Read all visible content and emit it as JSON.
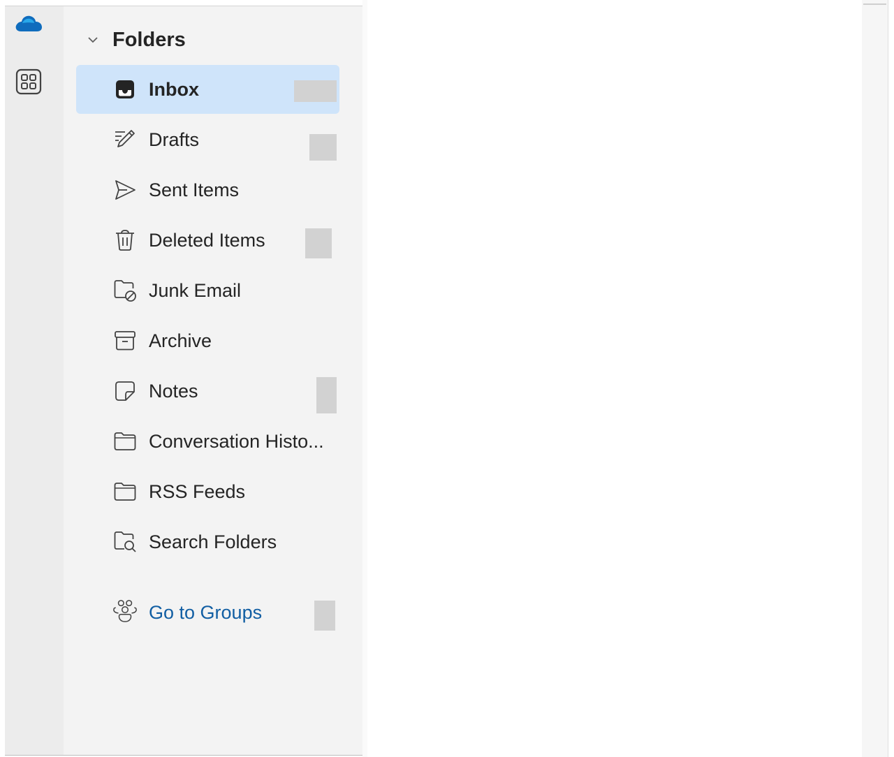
{
  "rail": {
    "app_icon": "onedrive-cloud-icon",
    "apps_icon": "apps-grid-icon",
    "accent": "#0f6cbd"
  },
  "folders": {
    "section_title": "Folders",
    "items": [
      {
        "label": "Inbox",
        "icon": "inbox-icon",
        "selected": true
      },
      {
        "label": "Drafts",
        "icon": "drafts-pencil-icon"
      },
      {
        "label": "Sent Items",
        "icon": "send-icon"
      },
      {
        "label": "Deleted Items",
        "icon": "trash-icon"
      },
      {
        "label": "Junk Email",
        "icon": "junk-folder-icon"
      },
      {
        "label": "Archive",
        "icon": "archive-icon"
      },
      {
        "label": "Notes",
        "icon": "note-icon"
      },
      {
        "label": "Conversation Histo...",
        "icon": "folder-icon"
      },
      {
        "label": "RSS Feeds",
        "icon": "folder-icon"
      },
      {
        "label": "Search Folders",
        "icon": "search-folder-icon"
      }
    ],
    "groups_link": {
      "label": "Go to Groups",
      "icon": "people-group-icon",
      "color": "#115ea3"
    },
    "selected_bg": "#cfe4fa"
  }
}
